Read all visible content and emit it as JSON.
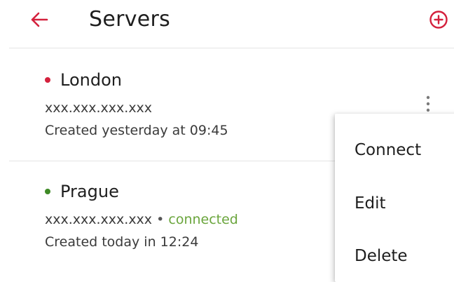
{
  "header": {
    "title": "Servers",
    "back_icon": "arrow-left-icon",
    "add_icon": "plus-circle-icon",
    "accent_color": "#d4213d"
  },
  "servers": [
    {
      "name": "London",
      "status_color": "#d4213d",
      "address": "xxx.xxx.xxx.xxx",
      "separator": "",
      "connection_status": "",
      "created": "Created yesterday at 09:45"
    },
    {
      "name": "Prague",
      "status_color": "#3f8a26",
      "address": "xxx.xxx.xxx.xxx",
      "separator": "•",
      "connection_status": "connected",
      "created": "Created today in 12:24"
    }
  ],
  "more_icon": "more-vertical-icon",
  "context_menu": {
    "items": [
      {
        "label": "Connect"
      },
      {
        "label": "Edit"
      },
      {
        "label": "Delete"
      }
    ]
  }
}
